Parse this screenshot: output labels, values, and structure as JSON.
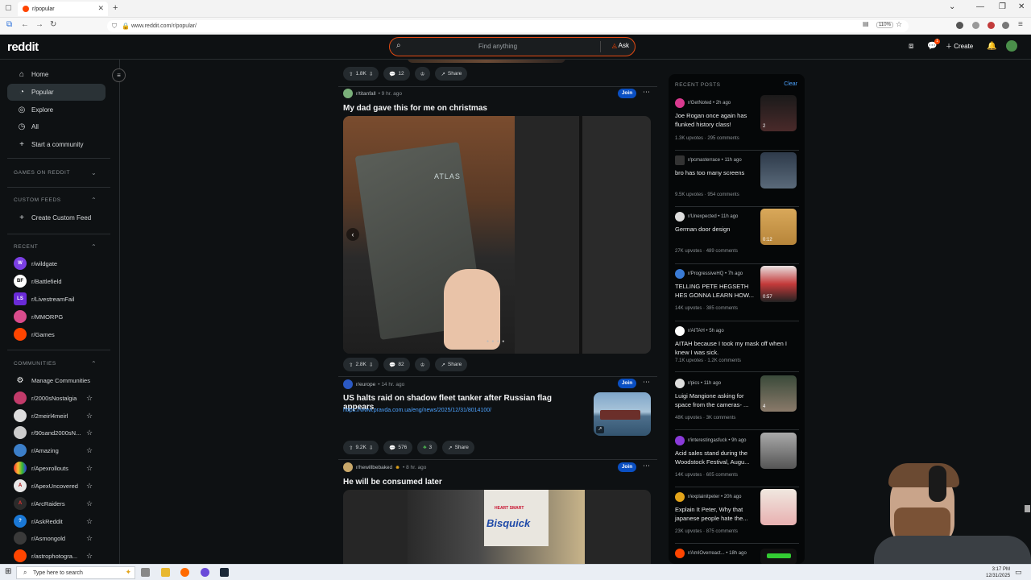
{
  "browser": {
    "tab_title": "r/popular",
    "url": "www.reddit.com/r/popular/",
    "zoom": "110%"
  },
  "header": {
    "logo": "reddit",
    "search_placeholder": "Find anything",
    "ask_label": "Ask",
    "create_label": "Create",
    "notif_count": "1"
  },
  "sidebar": {
    "nav": [
      {
        "label": "Home",
        "icon": "home-icon"
      },
      {
        "label": "Popular",
        "icon": "popular-icon"
      },
      {
        "label": "Explore",
        "icon": "explore-icon"
      },
      {
        "label": "All",
        "icon": "all-icon"
      },
      {
        "label": "Start a community",
        "icon": "plus-icon"
      }
    ],
    "games_header": "GAMES ON REDDIT",
    "custom_feeds_header": "CUSTOM FEEDS",
    "create_custom_feed": "Create Custom Feed",
    "recent_header": "RECENT",
    "recent": [
      {
        "label": "r/wildgate",
        "color": "#7b3fe4"
      },
      {
        "label": "r/Battlefield",
        "color": "#ffffff"
      },
      {
        "label": "r/LivestreamFail",
        "color": "#6a2bd9"
      },
      {
        "label": "r/MMORPG",
        "color": "#d94c8c"
      },
      {
        "label": "r/Games",
        "color": "#ff4500"
      }
    ],
    "communities_header": "COMMUNITIES",
    "manage_communities": "Manage Communities",
    "communities": [
      {
        "label": "r/2000sNostalgia",
        "color": "#c23b6a"
      },
      {
        "label": "r/2meirl4meirl",
        "color": "#dddddd"
      },
      {
        "label": "r/90sand2000sN...",
        "color": "#cccccc"
      },
      {
        "label": "r/Amazing",
        "color": "#3c7fc9"
      },
      {
        "label": "r/Apexrollouts",
        "color": "#e3a41a"
      },
      {
        "label": "r/ApexUncovered",
        "color": "#e8e8e8"
      },
      {
        "label": "r/ArcRaiders",
        "color": "#2b2b2b"
      },
      {
        "label": "r/AskReddit",
        "color": "#1a78d6"
      },
      {
        "label": "r/Asmongold",
        "color": "#3a3a3a"
      },
      {
        "label": "r/astrophotogra...",
        "color": "#ff4500"
      }
    ]
  },
  "feed": {
    "post0": {
      "upvotes": "1.8K",
      "comments": "12",
      "share": "Share"
    },
    "post1": {
      "subreddit": "r/titanfall",
      "time": "9 hr. ago",
      "join": "Join",
      "title": "My dad gave this for me on christmas",
      "upvotes": "2.8K",
      "comments": "82",
      "share": "Share"
    },
    "post2": {
      "subreddit": "r/europe",
      "time": "14 hr. ago",
      "join": "Join",
      "title": "US halts raid on shadow fleet tanker after Russian flag appears",
      "link": "https://www.pravda.com.ua/eng/news/2025/12/31/8014100/",
      "upvotes": "9.2K",
      "comments": "576",
      "awards": "3",
      "share": "Share"
    },
    "post3": {
      "subreddit": "r/hewillbebaked",
      "time": "8 hr. ago",
      "join": "Join",
      "title": "He will be consumed later",
      "box_text_1": "HEART SMART",
      "box_text_2": "Bisquick"
    },
    "atlas_text": "ATLAS"
  },
  "recent_posts": {
    "header": "RECENT POSTS",
    "clear": "Clear",
    "items": [
      {
        "sub": "r/GetNoted",
        "time": "2h ago",
        "title": "Joe Rogan once again has flunked history class!",
        "upvotes": "1.3K upvotes",
        "comments": "295 comments",
        "badge": "2",
        "avcolor": "#d93a8f",
        "thumb": "#3a1f22"
      },
      {
        "sub": "r/pcmasterrace",
        "time": "11h ago",
        "title": "bro has too many screens",
        "upvotes": "9.5K upvotes",
        "comments": "954 comments",
        "badge": "",
        "avcolor": "#333333",
        "thumb": "#2e3a4a"
      },
      {
        "sub": "r/Unexpected",
        "time": "11h ago",
        "title": "German door design",
        "upvotes": "27K upvotes",
        "comments": "489 comments",
        "badge": "0:12",
        "avcolor": "#dddddd",
        "thumb": "#c79a4a"
      },
      {
        "sub": "r/ProgressiveHQ",
        "time": "7h ago",
        "title": "TELLING PETE HEGSETH HES GONNA LEARN HOW...",
        "upvotes": "14K upvotes",
        "comments": "385 comments",
        "badge": "0:57",
        "avcolor": "#3a7bd5",
        "thumb": "#b83a3a"
      },
      {
        "sub": "r/AITAH",
        "time": "5h ago",
        "title": "AITAH because I took my mask off when I knew I was sick.",
        "upvotes": "7.1K upvotes",
        "comments": "1.2K comments",
        "badge": "",
        "avcolor": "#ffffff",
        "thumb": ""
      },
      {
        "sub": "r/pics",
        "time": "11h ago",
        "title": "Luigi Mangione asking for space from the cameras- ...",
        "upvotes": "48K upvotes",
        "comments": "3K comments",
        "badge": "4",
        "avcolor": "#dddddd",
        "thumb": "#6a5a4a"
      },
      {
        "sub": "r/interestingasfuck",
        "time": "9h ago",
        "title": "Acid sales stand during the Woodstock Festival, Augu...",
        "upvotes": "14K upvotes",
        "comments": "605 comments",
        "badge": "",
        "avcolor": "#8a3ad9",
        "thumb": "#777777"
      },
      {
        "sub": "r/explainitpeter",
        "time": "20h ago",
        "title": "Explain It Peter, Why that japanese people hate the...",
        "upvotes": "23K upvotes",
        "comments": "875 comments",
        "badge": "",
        "avcolor": "#e3a41a",
        "thumb": "#e8d8c8"
      },
      {
        "sub": "r/AmIOverreact...",
        "time": "18h ago",
        "title": "",
        "upvotes": "",
        "comments": "",
        "badge": "",
        "avcolor": "#ff4500",
        "thumb": "#111111"
      }
    ]
  },
  "taskbar": {
    "search": "Type here to search",
    "time": "3:17 PM",
    "date": "12/31/2025"
  }
}
